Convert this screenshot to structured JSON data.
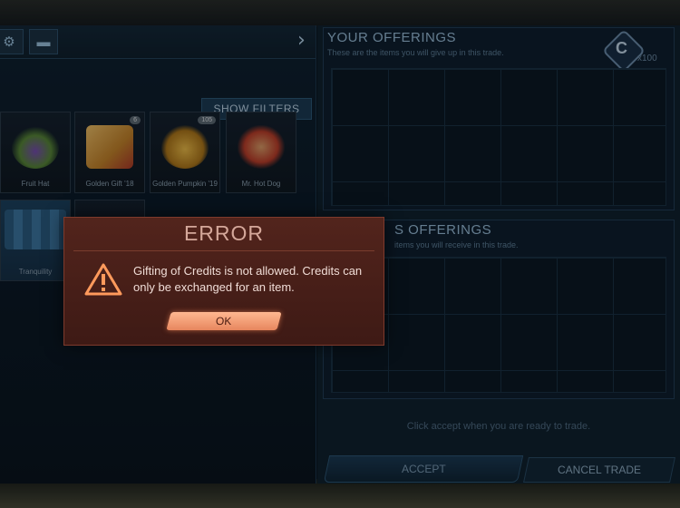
{
  "inventory": {
    "show_filters_label": "SHOW FILTERS",
    "items": [
      {
        "name": "Fruit Hat",
        "badge": ""
      },
      {
        "name": "Golden Gift '18",
        "badge": "6"
      },
      {
        "name": "Golden Pumpkin '19",
        "badge": "105"
      },
      {
        "name": "Mr. Hot Dog",
        "badge": ""
      },
      {
        "name": "Tranquility",
        "badge": ""
      }
    ]
  },
  "trade": {
    "your_offerings_title": "YOUR OFFERINGS",
    "your_offerings_subtitle": "These are the items you will give up in this trade.",
    "their_offerings_title": "S OFFERINGS",
    "their_offerings_subtitle": "items you will receive in this trade.",
    "credits_count": "x100",
    "ready_text": "Click accept when you are ready to trade.",
    "accept_label": "ACCEPT",
    "cancel_label": "CANCEL TRADE"
  },
  "error_modal": {
    "title": "ERROR",
    "message": "Gifting of Credits is not allowed. Credits can only be exchanged for an item.",
    "ok_label": "OK"
  },
  "colors": {
    "modal_bg": "#52241c",
    "ok_button": "#ffb891",
    "panel_accent": "#9bc0dd"
  }
}
